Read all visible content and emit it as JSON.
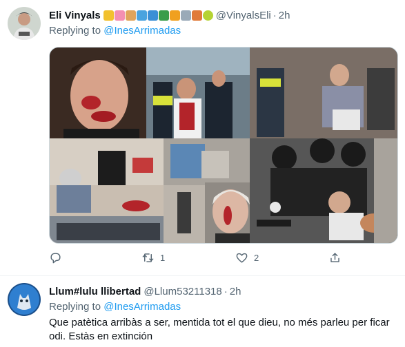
{
  "tweets": [
    {
      "name": "Eli Vinyals",
      "emojis": [
        "ribbon",
        "tulip",
        "dog",
        "dolphin",
        "whale",
        "tree",
        "tent",
        "airplane",
        "sailboat",
        "tennis"
      ],
      "handle": "@VinyalsEli",
      "dot": "·",
      "time": "2h",
      "replying_prefix": "Replying to ",
      "replying_to": "@InesArrimadas",
      "media_alt": "photo collage",
      "actions": {
        "reply_count": "",
        "retweet_count": "1",
        "like_count": "2"
      }
    },
    {
      "name": "Llum#lulu llibertad",
      "handle": "@Llum53211318",
      "dot": "·",
      "time": "2h",
      "replying_prefix": "Replying to ",
      "replying_to": "@InesArrimadas",
      "text": "Que patètica arribàs a ser, mentida tot el que dieu, no més parleu per ficar odi. Estàs en extinción"
    }
  ],
  "colors": {
    "link": "#1d9bf0",
    "secondary": "#536471",
    "primary": "#0f1419",
    "border": "#eff3f4"
  },
  "icons": [
    "reply-icon",
    "retweet-icon",
    "like-icon",
    "share-icon"
  ]
}
